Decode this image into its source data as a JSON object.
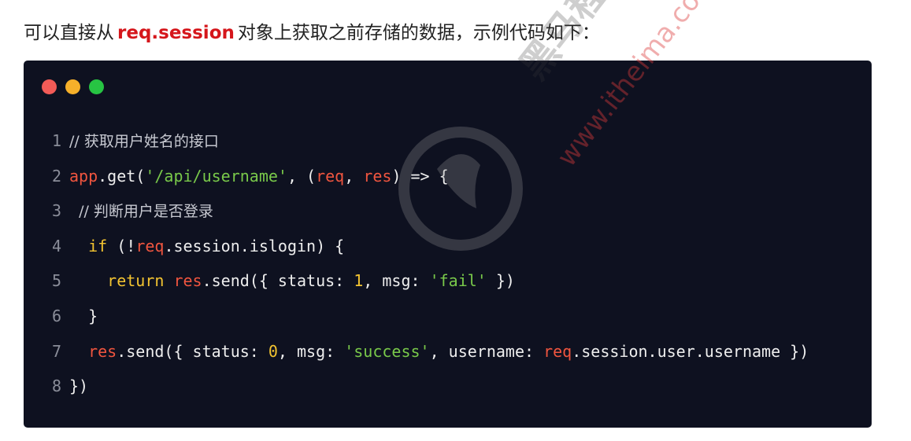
{
  "intro": {
    "prefix": "可以直接从",
    "keyword": "req.session",
    "suffix": "对象上获取之前存储的数据，示例代码如下："
  },
  "window_dots": [
    {
      "name": "close",
      "color": "#f25b57"
    },
    {
      "name": "minimize",
      "color": "#f6b02a"
    },
    {
      "name": "maximize",
      "color": "#27c443"
    }
  ],
  "code_lines": [
    {
      "n": "1",
      "tokens": [
        {
          "t": "// ",
          "c": "comment"
        },
        {
          "t": "获取用户姓名的接口",
          "c": "comment"
        }
      ]
    },
    {
      "n": "2",
      "tokens": [
        {
          "t": "app",
          "c": "var"
        },
        {
          "t": ".get(",
          "c": "plain"
        },
        {
          "t": "'/api/username'",
          "c": "str"
        },
        {
          "t": ", (",
          "c": "plain"
        },
        {
          "t": "req",
          "c": "var"
        },
        {
          "t": ", ",
          "c": "plain"
        },
        {
          "t": "res",
          "c": "var"
        },
        {
          "t": ") => {",
          "c": "plain"
        }
      ]
    },
    {
      "n": "3",
      "tokens": [
        {
          "t": "  // ",
          "c": "comment"
        },
        {
          "t": "判断用户是否登录",
          "c": "comment"
        }
      ]
    },
    {
      "n": "4",
      "tokens": [
        {
          "t": "  ",
          "c": "plain"
        },
        {
          "t": "if",
          "c": "kw"
        },
        {
          "t": " (!",
          "c": "plain"
        },
        {
          "t": "req",
          "c": "var"
        },
        {
          "t": ".session.islogin) {",
          "c": "plain"
        }
      ]
    },
    {
      "n": "5",
      "tokens": [
        {
          "t": "    ",
          "c": "plain"
        },
        {
          "t": "return",
          "c": "kw"
        },
        {
          "t": " ",
          "c": "plain"
        },
        {
          "t": "res",
          "c": "var"
        },
        {
          "t": ".send({ status: ",
          "c": "plain"
        },
        {
          "t": "1",
          "c": "num"
        },
        {
          "t": ", msg: ",
          "c": "plain"
        },
        {
          "t": "'fail'",
          "c": "str"
        },
        {
          "t": " })",
          "c": "plain"
        }
      ]
    },
    {
      "n": "6",
      "tokens": [
        {
          "t": "  }",
          "c": "plain"
        }
      ]
    },
    {
      "n": "7",
      "tokens": [
        {
          "t": "  ",
          "c": "plain"
        },
        {
          "t": "res",
          "c": "var"
        },
        {
          "t": ".send({ status: ",
          "c": "plain"
        },
        {
          "t": "0",
          "c": "num"
        },
        {
          "t": ", msg: ",
          "c": "plain"
        },
        {
          "t": "'success'",
          "c": "str"
        },
        {
          "t": ", username: ",
          "c": "plain"
        },
        {
          "t": "req",
          "c": "var"
        },
        {
          "t": ".session.user.username })",
          "c": "plain"
        }
      ]
    },
    {
      "n": "8",
      "tokens": [
        {
          "t": "})",
          "c": "plain"
        }
      ]
    }
  ],
  "watermark": {
    "brand": "黑马程序员",
    "url": "www.itheima.com"
  }
}
